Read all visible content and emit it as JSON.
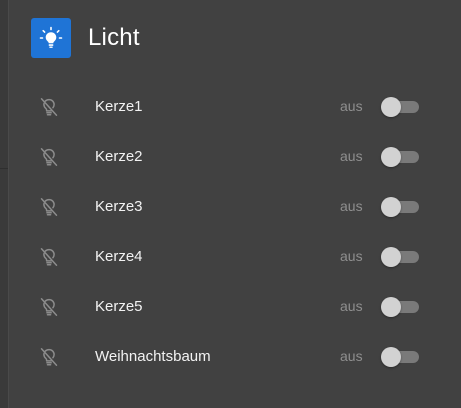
{
  "header": {
    "title": "Licht",
    "icon": "lightbulb-icon",
    "icon_bg_color": "#1f74d6"
  },
  "devices": [
    {
      "name": "Kerze1",
      "state": "aus",
      "on": false,
      "icon": "lightbulb-off-icon"
    },
    {
      "name": "Kerze2",
      "state": "aus",
      "on": false,
      "icon": "lightbulb-off-icon"
    },
    {
      "name": "Kerze3",
      "state": "aus",
      "on": false,
      "icon": "lightbulb-off-icon"
    },
    {
      "name": "Kerze4",
      "state": "aus",
      "on": false,
      "icon": "lightbulb-off-icon"
    },
    {
      "name": "Kerze5",
      "state": "aus",
      "on": false,
      "icon": "lightbulb-off-icon"
    },
    {
      "name": "Weihnachtsbaum",
      "state": "aus",
      "on": false,
      "icon": "lightbulb-off-icon"
    }
  ]
}
